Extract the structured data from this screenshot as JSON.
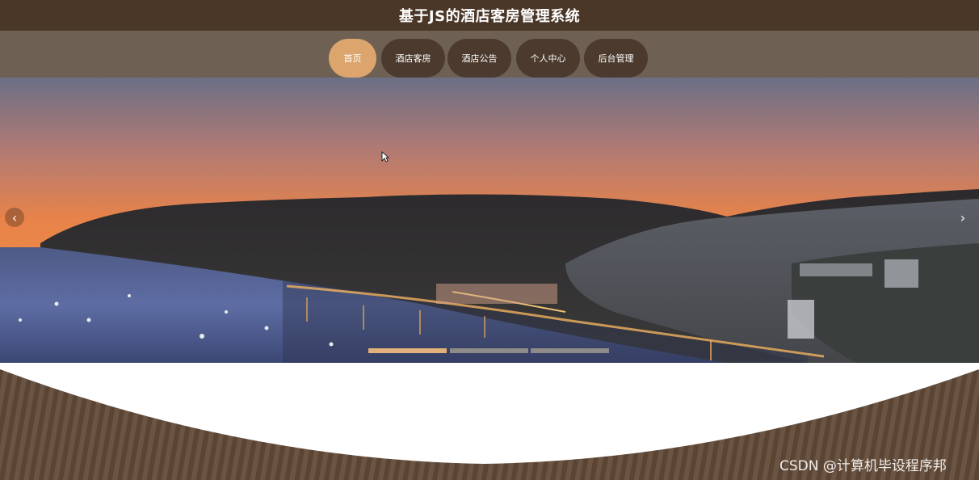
{
  "header": {
    "title": "基于JS的酒店客房管理系统"
  },
  "nav": {
    "items": [
      {
        "label": "首页",
        "active": true
      },
      {
        "label": "酒店客房",
        "active": false
      },
      {
        "label": "酒店公告",
        "active": false
      },
      {
        "label": "个人中心",
        "active": false
      },
      {
        "label": "后台管理",
        "active": false
      }
    ]
  },
  "carousel": {
    "prev_icon": "chevron-left-icon",
    "next_icon": "chevron-right-icon",
    "prev_glyph": "‹",
    "next_glyph": "›",
    "slide_count": 3,
    "active_slide": 1
  },
  "watermark": {
    "text": "CSDN @计算机毕设程序邦"
  },
  "colors": {
    "header_bg": "#4a3728",
    "nav_bg": "#6e6153",
    "nav_item_bg": "#4b3a2d",
    "nav_active_bg": "#dca56d",
    "indicator_active": "#e2b07a"
  }
}
